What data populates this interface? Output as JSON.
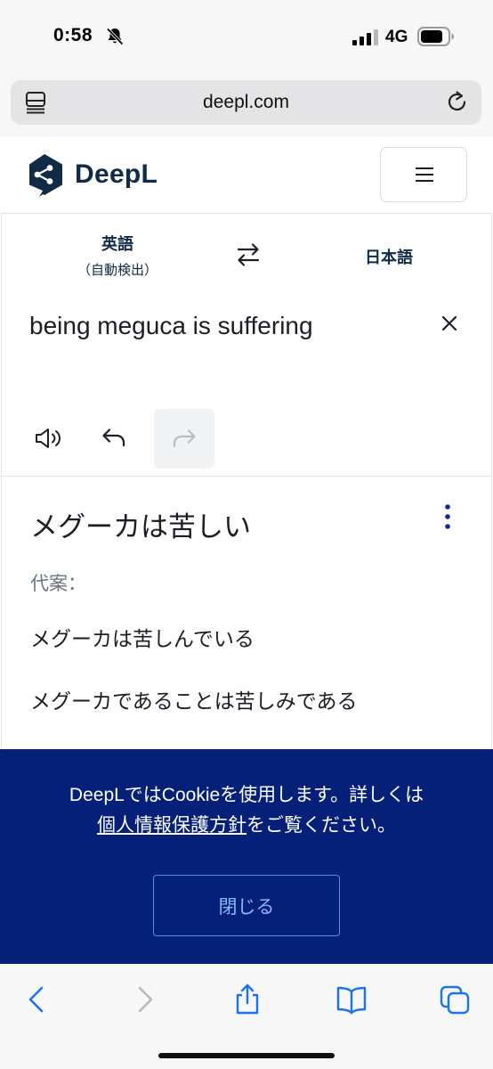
{
  "status_bar": {
    "time": "0:58",
    "network": "4G"
  },
  "browser": {
    "url": "deepl.com"
  },
  "header": {
    "logo_text": "DeepL"
  },
  "language_bar": {
    "source_label": "英語",
    "source_sub": "（自動検出）",
    "target_label": "日本語"
  },
  "source_panel": {
    "text": "being meguca is suffering"
  },
  "target_panel": {
    "translation": "メグーカは苦しい",
    "alternatives_heading": "代案：",
    "alternatives": [
      "メグーカは苦しんでいる",
      "メグーカであることは苦しみである"
    ]
  },
  "cookie_banner": {
    "line1": "DeepLではCookieを使用します。詳しくは",
    "link_text": "個人情報保護方針",
    "line2_suffix": "をご覧ください。",
    "close_label": "閉じる"
  },
  "colors": {
    "brand_navy": "#0f2b46",
    "banner_bg": "#042078",
    "link_blue": "#1a73e8"
  },
  "icons": [
    "bell-slash-icon",
    "signal-icon",
    "battery-icon",
    "page-menu-icon",
    "reload-icon",
    "deepl-logo",
    "hamburger-icon",
    "swap-icon",
    "close-icon",
    "speaker-icon",
    "undo-icon",
    "redo-icon",
    "more-vertical-icon",
    "back-icon",
    "forward-icon",
    "share-icon",
    "bookmarks-icon",
    "tabs-icon"
  ]
}
